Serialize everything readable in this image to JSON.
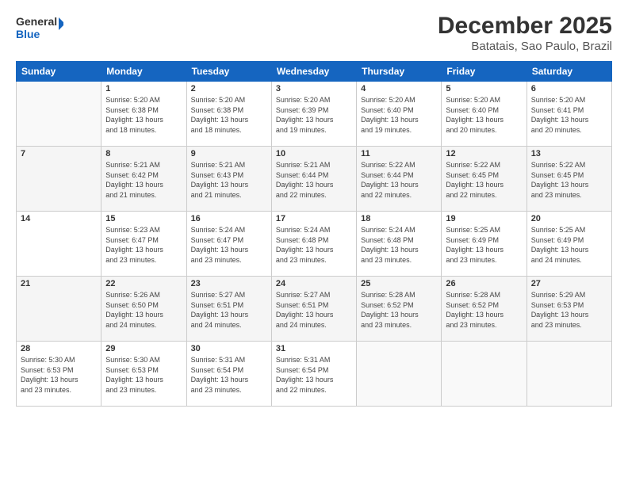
{
  "logo": {
    "line1": "General",
    "line2": "Blue"
  },
  "title": "December 2025",
  "subtitle": "Batatais, Sao Paulo, Brazil",
  "days_of_week": [
    "Sunday",
    "Monday",
    "Tuesday",
    "Wednesday",
    "Thursday",
    "Friday",
    "Saturday"
  ],
  "weeks": [
    [
      {
        "day": "",
        "info": ""
      },
      {
        "day": "1",
        "info": "Sunrise: 5:20 AM\nSunset: 6:38 PM\nDaylight: 13 hours\nand 18 minutes."
      },
      {
        "day": "2",
        "info": "Sunrise: 5:20 AM\nSunset: 6:38 PM\nDaylight: 13 hours\nand 18 minutes."
      },
      {
        "day": "3",
        "info": "Sunrise: 5:20 AM\nSunset: 6:39 PM\nDaylight: 13 hours\nand 19 minutes."
      },
      {
        "day": "4",
        "info": "Sunrise: 5:20 AM\nSunset: 6:40 PM\nDaylight: 13 hours\nand 19 minutes."
      },
      {
        "day": "5",
        "info": "Sunrise: 5:20 AM\nSunset: 6:40 PM\nDaylight: 13 hours\nand 20 minutes."
      },
      {
        "day": "6",
        "info": "Sunrise: 5:20 AM\nSunset: 6:41 PM\nDaylight: 13 hours\nand 20 minutes."
      }
    ],
    [
      {
        "day": "7",
        "info": ""
      },
      {
        "day": "8",
        "info": "Sunrise: 5:21 AM\nSunset: 6:42 PM\nDaylight: 13 hours\nand 21 minutes."
      },
      {
        "day": "9",
        "info": "Sunrise: 5:21 AM\nSunset: 6:43 PM\nDaylight: 13 hours\nand 21 minutes."
      },
      {
        "day": "10",
        "info": "Sunrise: 5:21 AM\nSunset: 6:44 PM\nDaylight: 13 hours\nand 22 minutes."
      },
      {
        "day": "11",
        "info": "Sunrise: 5:22 AM\nSunset: 6:44 PM\nDaylight: 13 hours\nand 22 minutes."
      },
      {
        "day": "12",
        "info": "Sunrise: 5:22 AM\nSunset: 6:45 PM\nDaylight: 13 hours\nand 22 minutes."
      },
      {
        "day": "13",
        "info": "Sunrise: 5:22 AM\nSunset: 6:45 PM\nDaylight: 13 hours\nand 23 minutes."
      }
    ],
    [
      {
        "day": "14",
        "info": ""
      },
      {
        "day": "15",
        "info": "Sunrise: 5:23 AM\nSunset: 6:47 PM\nDaylight: 13 hours\nand 23 minutes."
      },
      {
        "day": "16",
        "info": "Sunrise: 5:24 AM\nSunset: 6:47 PM\nDaylight: 13 hours\nand 23 minutes."
      },
      {
        "day": "17",
        "info": "Sunrise: 5:24 AM\nSunset: 6:48 PM\nDaylight: 13 hours\nand 23 minutes."
      },
      {
        "day": "18",
        "info": "Sunrise: 5:24 AM\nSunset: 6:48 PM\nDaylight: 13 hours\nand 23 minutes."
      },
      {
        "day": "19",
        "info": "Sunrise: 5:25 AM\nSunset: 6:49 PM\nDaylight: 13 hours\nand 23 minutes."
      },
      {
        "day": "20",
        "info": "Sunrise: 5:25 AM\nSunset: 6:49 PM\nDaylight: 13 hours\nand 24 minutes."
      }
    ],
    [
      {
        "day": "21",
        "info": ""
      },
      {
        "day": "22",
        "info": "Sunrise: 5:26 AM\nSunset: 6:50 PM\nDaylight: 13 hours\nand 24 minutes."
      },
      {
        "day": "23",
        "info": "Sunrise: 5:27 AM\nSunset: 6:51 PM\nDaylight: 13 hours\nand 24 minutes."
      },
      {
        "day": "24",
        "info": "Sunrise: 5:27 AM\nSunset: 6:51 PM\nDaylight: 13 hours\nand 24 minutes."
      },
      {
        "day": "25",
        "info": "Sunrise: 5:28 AM\nSunset: 6:52 PM\nDaylight: 13 hours\nand 23 minutes."
      },
      {
        "day": "26",
        "info": "Sunrise: 5:28 AM\nSunset: 6:52 PM\nDaylight: 13 hours\nand 23 minutes."
      },
      {
        "day": "27",
        "info": "Sunrise: 5:29 AM\nSunset: 6:53 PM\nDaylight: 13 hours\nand 23 minutes."
      }
    ],
    [
      {
        "day": "28",
        "info": "Sunrise: 5:30 AM\nSunset: 6:53 PM\nDaylight: 13 hours\nand 23 minutes."
      },
      {
        "day": "29",
        "info": "Sunrise: 5:30 AM\nSunset: 6:53 PM\nDaylight: 13 hours\nand 23 minutes."
      },
      {
        "day": "30",
        "info": "Sunrise: 5:31 AM\nSunset: 6:54 PM\nDaylight: 13 hours\nand 23 minutes."
      },
      {
        "day": "31",
        "info": "Sunrise: 5:31 AM\nSunset: 6:54 PM\nDaylight: 13 hours\nand 22 minutes."
      },
      {
        "day": "",
        "info": ""
      },
      {
        "day": "",
        "info": ""
      },
      {
        "day": "",
        "info": ""
      }
    ]
  ]
}
